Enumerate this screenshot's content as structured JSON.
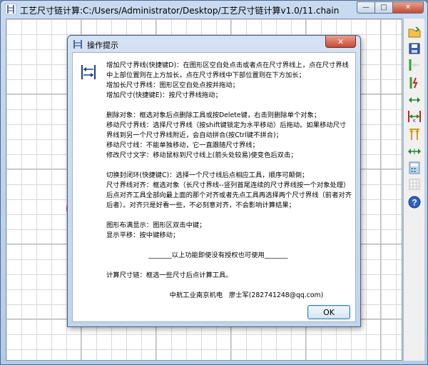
{
  "window": {
    "title": "工艺尺寸链计算:C:/Users/Administrator/Desktop/工艺尺寸链计算v1.0/11.chain",
    "min_glyph": "—",
    "max_glyph": "□",
    "close_glyph": "✕"
  },
  "toolbar": {
    "tools": [
      {
        "icon": "open-folder-icon"
      },
      {
        "icon": "save-disk-icon"
      },
      {
        "icon": "add-dimension-boundary-icon"
      },
      {
        "icon": "add-dimension-icon"
      },
      {
        "icon": "move-dimension-icon"
      },
      {
        "icon": "align-dimension-icon"
      },
      {
        "icon": "closed-loop-icon"
      },
      {
        "icon": "horizontal-arrows-icon"
      },
      {
        "icon": "calculator-icon"
      },
      {
        "icon": "grid-icon"
      },
      {
        "icon": "help-icon"
      }
    ],
    "help_glyph": "?"
  },
  "dialog": {
    "title": "操作提示",
    "close_glyph": "✕",
    "body_text": "增加尺寸界线(快捷键D)：在图形区空白处点击或者点在尺寸界线上，点在尺寸界线中上部位置则在上方加长，点在尺寸界线中下部位置则在下方加长；\n增加长尺寸界线：图形区空白处点按并拖动；\n增加尺寸(快捷键E)：按尺寸界线拖动；\n\n删除对象：框选对象后点删除工具或按Delete键，右击则删除单个对象；\n移动尺寸界线：选择尺寸界线（按shift键锁定为水平移动）后拖动。如果移动尺寸界线到另一个尺寸界线附近，会自动拼合(按Ctrl键不拼合)；\n移动尺寸线：不能单独移动，它一直跟随尺寸界线；\n修改尺寸文字：移动鼠标到尺寸线上(箭头处较易)使变色后双击；\n\n切换封闭环(快捷键C)：选择一个尺寸线后点相应工具，顺序可颠倒；\n尺寸界线对齐：框选对象（长尺寸界线--竖列首尾连续的尺寸界线按一个对象处理）后点对齐工具全部向最上面的那个对齐或者先点工具再选择两个尺寸界线（前者对齐后者）。对齐只是好看一些，不必刻意对齐，不会影响计算结果；\n\n图形布满显示：图形区双击中键；\n显示平移：按中键移动；\n\n                    _______以上功能即使没有授权也可使用_______\n\n计算尺寸链：框选一些尺寸后点计算工具。\n\n                              中航工业南京机电   廖士军(282741248@qq.com)",
    "ok_label": "OK"
  }
}
